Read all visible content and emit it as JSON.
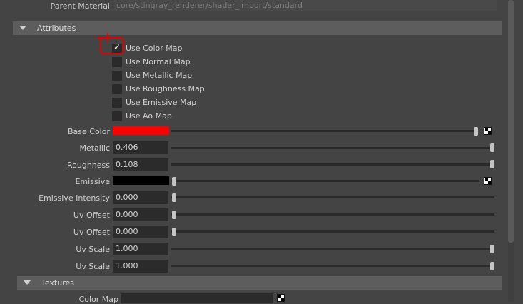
{
  "parent_material": {
    "label": "Parent Material",
    "value": "core/stingray_renderer/shader_import/standard"
  },
  "sections": {
    "attributes": "Attributes",
    "textures": "Textures"
  },
  "checkboxes": [
    {
      "label": "Use Color Map",
      "checked": true
    },
    {
      "label": "Use Normal Map",
      "checked": false
    },
    {
      "label": "Use Metallic Map",
      "checked": false
    },
    {
      "label": "Use Roughness Map",
      "checked": false
    },
    {
      "label": "Use Emissive Map",
      "checked": false
    },
    {
      "label": "Use Ao Map",
      "checked": false
    }
  ],
  "check_glyph": "✓",
  "attributes": [
    {
      "label": "Base Color",
      "color": "#ff0000",
      "slider_fraction": 1.0,
      "has_map_button": true
    },
    {
      "label": "Metallic",
      "value": "0.406",
      "slider_fraction": 1.0
    },
    {
      "label": "Roughness",
      "value": "0.108",
      "slider_fraction": 1.0
    },
    {
      "label": "Emissive",
      "color": "#000000",
      "slider_fraction": 0.0,
      "has_map_button": true
    },
    {
      "label": "Emissive Intensity",
      "value": "0.000",
      "slider_fraction": 0.0
    },
    {
      "label": "Uv Offset",
      "value": "0.000",
      "slider_fraction": 0.0
    },
    {
      "label": "Uv Offset",
      "value": "0.000",
      "slider_fraction": 0.0
    },
    {
      "label": "Uv Scale",
      "value": "1.000",
      "slider_fraction": 1.0
    },
    {
      "label": "Uv Scale",
      "value": "1.000",
      "slider_fraction": 1.0
    }
  ],
  "textures": [
    {
      "label": "Color Map",
      "value": ""
    }
  ],
  "colors": {
    "panel": "#444444",
    "section_header": "#5d5d5d",
    "field": "#2b2b2b",
    "annotation": "#e00000"
  }
}
